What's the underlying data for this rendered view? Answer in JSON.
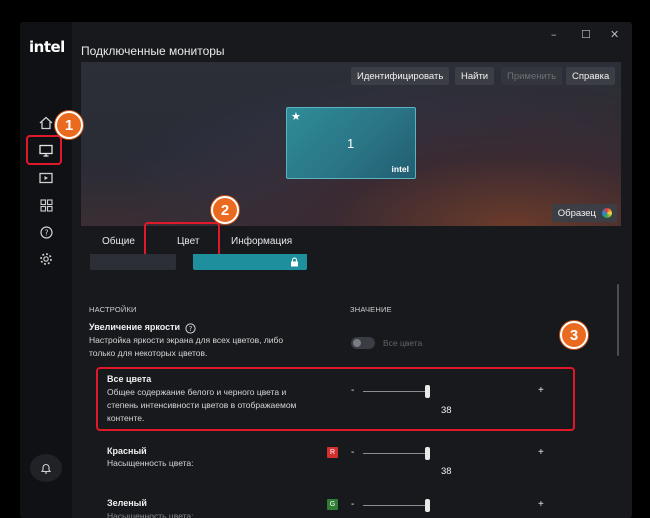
{
  "app": {
    "logo_text": "intel",
    "title": "Подключенные мониторы",
    "window_controls": {
      "minimize": "–",
      "maximize": "☐",
      "close": "✕"
    }
  },
  "sidebar": {
    "items": [
      {
        "icon": "home-icon"
      },
      {
        "icon": "display-icon",
        "active": true
      },
      {
        "icon": "video-icon"
      },
      {
        "icon": "apps-grid-icon"
      },
      {
        "icon": "help-icon"
      },
      {
        "icon": "settings-gear-icon"
      }
    ],
    "bottom_icon": "bell-icon"
  },
  "toolbar": {
    "identify": "Идентифицировать",
    "find": "Найти",
    "apply": "Применить",
    "help": "Справка"
  },
  "monitor": {
    "number": "1",
    "brand": "intel",
    "primary_icon": "star-icon"
  },
  "sample_button": "Образец",
  "tabs": [
    {
      "label": "Общие"
    },
    {
      "label": "Цвет",
      "active": true
    },
    {
      "label": "Информация"
    }
  ],
  "columns": {
    "settings": "НАСТРОЙКИ",
    "value": "ЗНАЧЕНИЕ"
  },
  "brightness_boost": {
    "title": "Увеличение яркости",
    "desc_line1": "Настройка яркости экрана для всех цветов, либо",
    "desc_line2": "только для некоторых цветов.",
    "toggle_label": "Все цвета",
    "toggle_on": false
  },
  "settings": [
    {
      "title": "Все цвета",
      "desc": [
        "Общее содержание белого и черного цвета и",
        "степень интенсивности цветов в отображаемом",
        "контенте."
      ],
      "value": "38",
      "minus": "-",
      "plus": "+"
    },
    {
      "title": "Красный",
      "desc": [
        "Насыщенность цвета:"
      ],
      "swatch_letter": "R",
      "swatch_color": "#d32f2f",
      "value": "38",
      "minus": "-",
      "plus": "+"
    },
    {
      "title": "Зеленый",
      "desc": [
        "Насыщенность цвета:"
      ],
      "swatch_letter": "G",
      "swatch_color": "#2e7d32",
      "minus": "-",
      "plus": "+"
    }
  ],
  "callouts": [
    "1",
    "2",
    "3"
  ],
  "colors": {
    "accent": "#1e9aa6",
    "highlight": "#e0192a",
    "callout": "#ea6a1f"
  }
}
